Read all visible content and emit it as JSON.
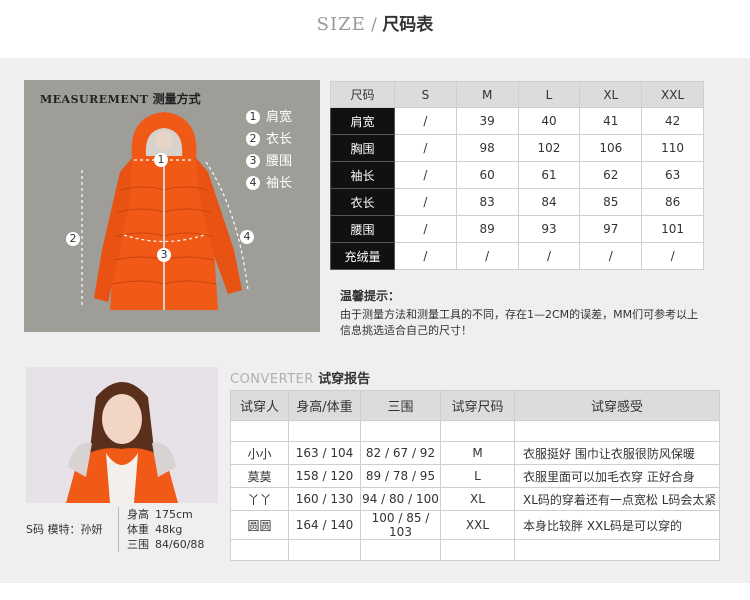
{
  "title": {
    "size_en": "SIZE",
    "slash": "/",
    "size_zh": "尺码表"
  },
  "measurement": {
    "title_en": "MEASUREMENT",
    "title_zh": "测量方式",
    "legend": [
      {
        "num": "1",
        "label": "肩宽"
      },
      {
        "num": "2",
        "label": "衣长"
      },
      {
        "num": "3",
        "label": "腰围"
      },
      {
        "num": "4",
        "label": "袖长"
      }
    ],
    "markers": [
      "1",
      "2",
      "3",
      "4"
    ]
  },
  "size_table": {
    "corner": "尺码",
    "sizes": [
      "S",
      "M",
      "L",
      "XL",
      "XXL"
    ],
    "rows": [
      {
        "name": "肩宽",
        "values": [
          "/",
          "39",
          "40",
          "41",
          "42"
        ]
      },
      {
        "name": "胸围",
        "values": [
          "/",
          "98",
          "102",
          "106",
          "110"
        ]
      },
      {
        "name": "袖长",
        "values": [
          "/",
          "60",
          "61",
          "62",
          "63"
        ]
      },
      {
        "name": "衣长",
        "values": [
          "/",
          "83",
          "84",
          "85",
          "86"
        ]
      },
      {
        "name": "腰围",
        "values": [
          "/",
          "89",
          "93",
          "97",
          "101"
        ]
      },
      {
        "name": "充绒量",
        "values": [
          "/",
          "/",
          "/",
          "/",
          "/"
        ]
      }
    ]
  },
  "tip": {
    "title": "温馨提示：",
    "lines": [
      "由于测量方法和测量工具的不同，存在1—2CM的误差，MM们可参考以上",
      "信息挑选适合自己的尺寸！"
    ]
  },
  "model": {
    "caption": "S码 模特：孙妍",
    "stats": [
      {
        "label": "身高",
        "value": "175cm"
      },
      {
        "label": "体重",
        "value": "48kg"
      },
      {
        "label": "三围",
        "value": "84/60/88"
      }
    ]
  },
  "converter": {
    "title_en": "CONVERTER",
    "title_zh": "试穿报告",
    "headers": [
      "试穿人",
      "身高/体重",
      "三围",
      "试穿尺码",
      "试穿感受"
    ],
    "rows": [
      {
        "name": "小小",
        "hw": "163 / 104",
        "bwh": "82 / 67 / 92",
        "size": "M",
        "feel": "衣服挺好  围巾让衣服很防风保暖"
      },
      {
        "name": "莫莫",
        "hw": "158 / 120",
        "bwh": "89 / 78 / 95",
        "size": "L",
        "feel": "衣服里面可以加毛衣穿 正好合身"
      },
      {
        "name": "丫丫",
        "hw": "160 / 130",
        "bwh": "94 / 80 / 100",
        "size": "XL",
        "feel": "XL码的穿着还有一点宽松  L码会太紧"
      },
      {
        "name": "圆圆",
        "hw": "164 / 140",
        "bwh": "100 / 85 / 103",
        "size": "XXL",
        "feel": "本身比较胖  XXL码是可以穿的"
      }
    ]
  },
  "colors": {
    "jacket": "#f05a16",
    "band": "#efefef",
    "measure_bg": "#9e9d98",
    "row_header": "#111111"
  }
}
